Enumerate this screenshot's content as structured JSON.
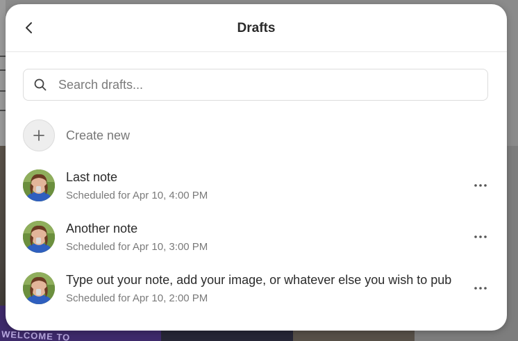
{
  "modal": {
    "title": "Drafts"
  },
  "search": {
    "placeholder": "Search drafts..."
  },
  "create": {
    "label": "Create new"
  },
  "drafts": [
    {
      "title": "Last note",
      "scheduled": "Scheduled for Apr 10, 4:00 PM"
    },
    {
      "title": "Another note",
      "scheduled": "Scheduled for Apr 10, 3:00 PM"
    },
    {
      "title": "Type out your note, add your image, or whatever else you wish to pub",
      "scheduled": "Scheduled for Apr 10, 2:00 PM"
    }
  ],
  "background": {
    "welcome_text": "WELCOME TO"
  },
  "colors": {
    "modal_bg": "#ffffff",
    "title_text": "#2a2a2a",
    "secondary_text": "#7a7a7a",
    "border": "#dcdcdc",
    "overlay": "#8b8b8b"
  },
  "icons": {
    "back": "chevron-left-icon",
    "search": "search-icon",
    "create": "plus-icon",
    "more": "more-horizontal-icon"
  }
}
